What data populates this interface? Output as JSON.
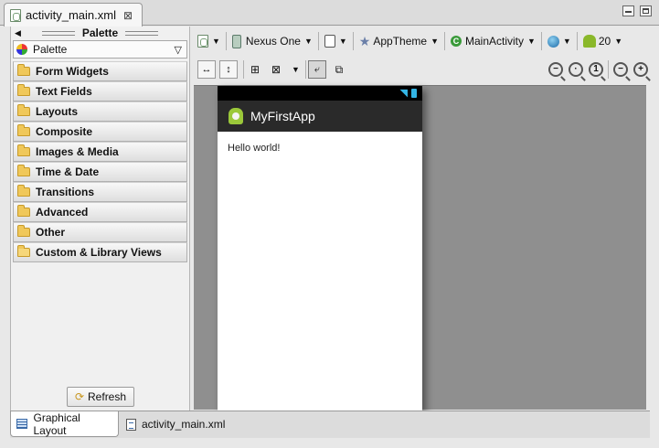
{
  "editor_tab": {
    "title": "activity_main.xml",
    "close": "⊠"
  },
  "palette": {
    "header": "Palette",
    "selector": "Palette",
    "categories": [
      "Form Widgets",
      "Text Fields",
      "Layouts",
      "Composite",
      "Images & Media",
      "Time & Date",
      "Transitions",
      "Advanced",
      "Other",
      "Custom & Library Views"
    ],
    "refresh": "Refresh"
  },
  "toolbar": {
    "device": "Nexus One",
    "theme": "AppTheme",
    "activity": "MainActivity",
    "api_level": "20"
  },
  "zoom_buttons": [
    "−",
    "·",
    "1",
    "−",
    "+"
  ],
  "device_preview": {
    "app_title": "MyFirstApp",
    "content_text": "Hello world!",
    "wifi": "◥",
    "accent": "#33b5e5"
  },
  "bottom_tabs": [
    "Graphical Layout",
    "activity_main.xml"
  ]
}
